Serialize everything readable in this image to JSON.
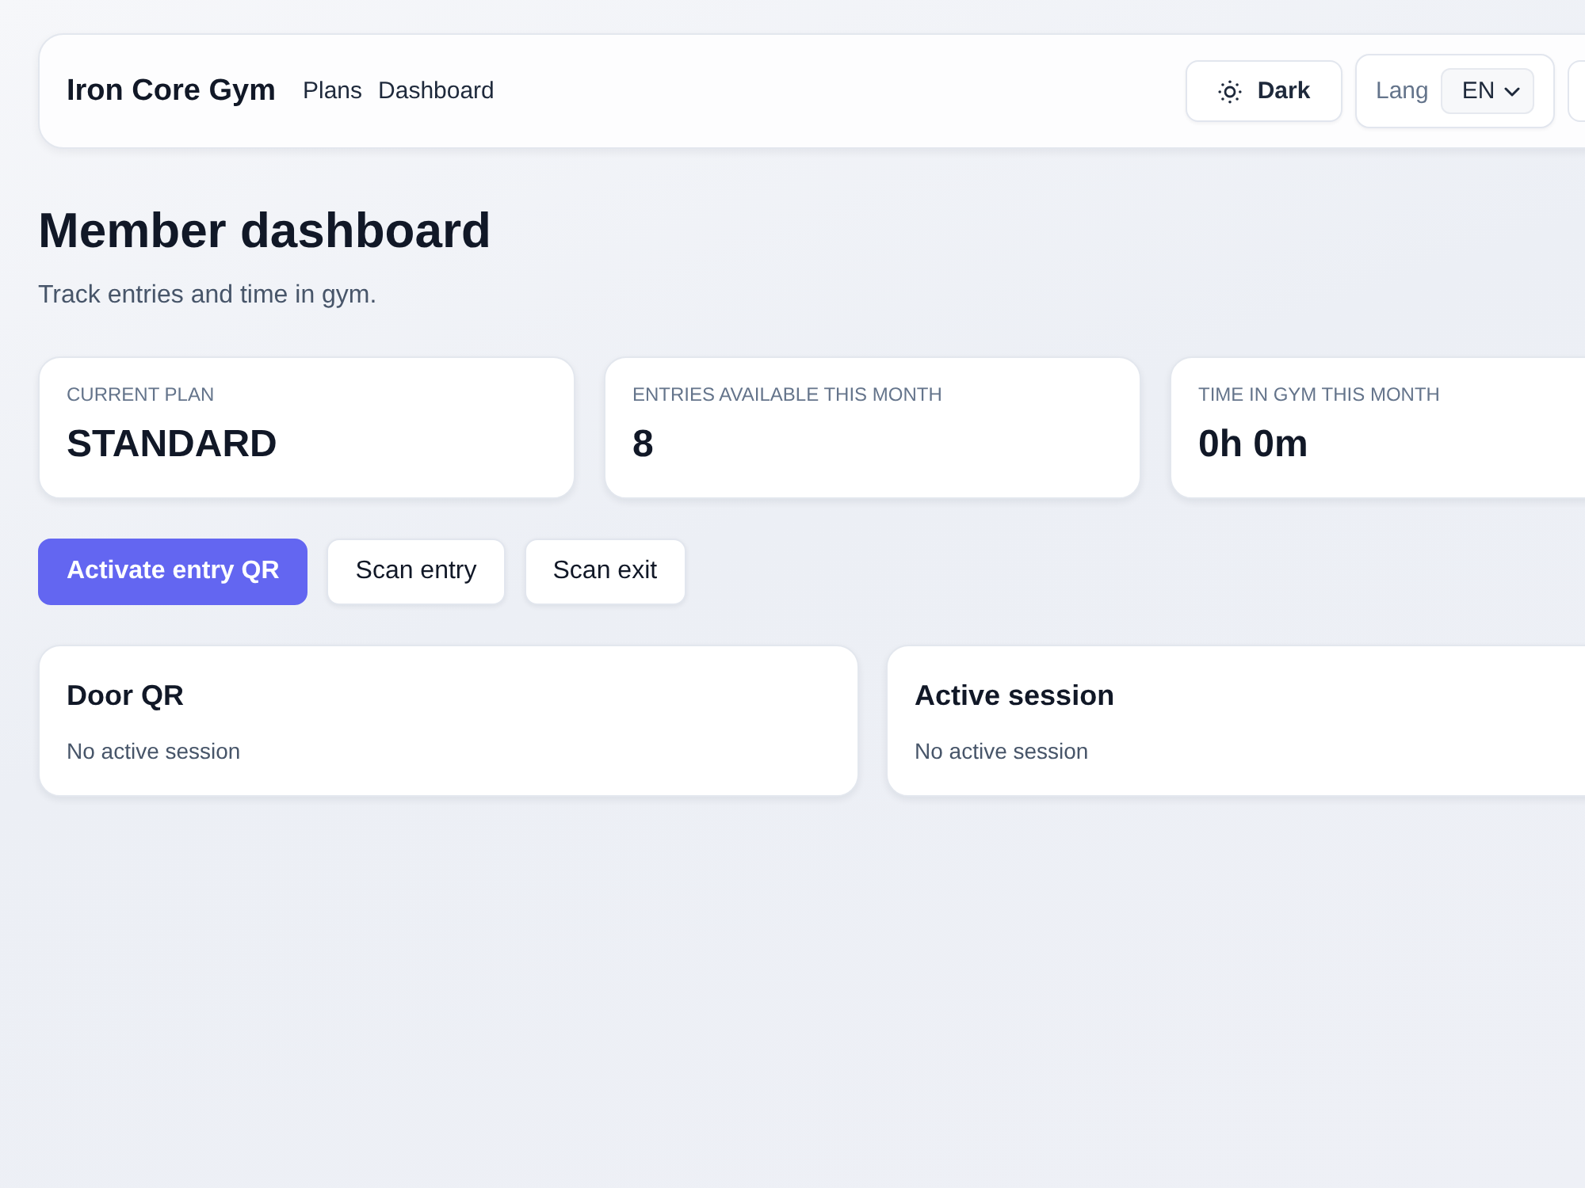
{
  "header": {
    "brand": "Iron Core Gym",
    "nav": [
      {
        "label": "Plans"
      },
      {
        "label": "Dashboard"
      }
    ],
    "theme_button": {
      "label": "Dark"
    },
    "language": {
      "label": "Lang",
      "value": "EN"
    }
  },
  "page": {
    "title": "Member dashboard",
    "subtitle": "Track entries and time in gym."
  },
  "stats": [
    {
      "label": "CURRENT PLAN",
      "value": "STANDARD"
    },
    {
      "label": "ENTRIES AVAILABLE THIS MONTH",
      "value": "8"
    },
    {
      "label": "TIME IN GYM THIS MONTH",
      "value": "0h 0m"
    }
  ],
  "actions": [
    {
      "label": "Activate entry QR",
      "kind": "primary"
    },
    {
      "label": "Scan entry",
      "kind": "secondary"
    },
    {
      "label": "Scan exit",
      "kind": "secondary"
    }
  ],
  "panels": [
    {
      "title": "Door QR",
      "text": "No active session"
    },
    {
      "title": "Active session",
      "text": "No active session"
    }
  ]
}
